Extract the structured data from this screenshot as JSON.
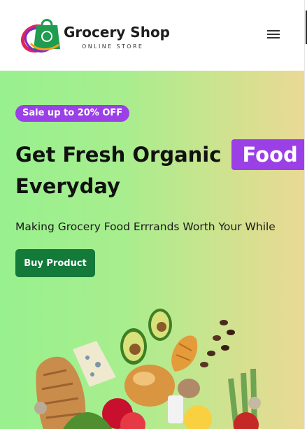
{
  "header": {
    "brand_name": "Grocery Shop",
    "brand_tagline": "ONLINE STORE",
    "menu_icon": "hamburger-menu-icon"
  },
  "hero": {
    "badge": "Sale up to 20% OFF",
    "headline_part1": "Get Fresh Organic",
    "headline_highlight": "Food",
    "headline_part2": "Everyday",
    "subtitle": "Making Grocery Food Errrands Worth Your While",
    "cta_label": "Buy Product",
    "image_subject": "assorted fresh produce"
  },
  "colors": {
    "accent_purple": "#9b3fe6",
    "cta_green": "#137a3a",
    "hero_gradient_start": "#98f08e",
    "hero_gradient_end": "#ead996"
  }
}
